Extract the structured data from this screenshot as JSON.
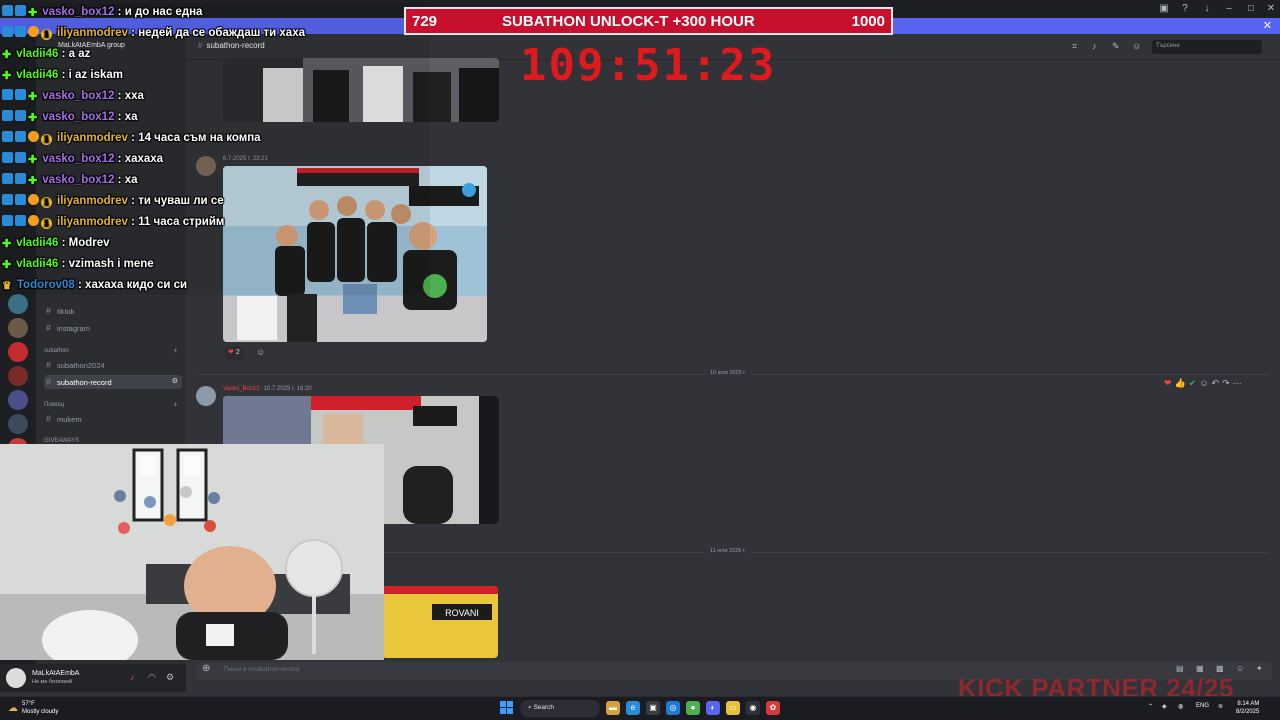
{
  "discord": {
    "server_name": "MaLkAtAEmbA group",
    "channel_header": "subathon-record",
    "search_placeholder": "Търсене",
    "sidebar": {
      "categories": [
        {
          "label": "subathon"
        },
        {
          "label": "Помощ"
        },
        {
          "label": "GIVEAWAYS"
        }
      ],
      "channels": [
        {
          "label": "tiktok"
        },
        {
          "label": "instagram"
        },
        {
          "label": "subathon2024"
        },
        {
          "label": "subathon-record"
        },
        {
          "label": "mukem"
        }
      ]
    },
    "messages": [
      {
        "author": "",
        "time": "6.7.2025 г. 23:21",
        "reaction_count": "2"
      },
      {
        "author": "Vasko_Box12",
        "time": "10.7.2025 г. 16:20"
      }
    ],
    "date_dividers": [
      "10 юли 2025 г.",
      "11 юли 2025 г."
    ],
    "composer_placeholder": "Пиши в #subathon-record",
    "user": {
      "name": "MaLkAtAEmbA",
      "status": "Не ме безпокой"
    }
  },
  "overlay": {
    "banner": {
      "left_value": "729",
      "title": "SUBATHON UNLOCK-T +300 HOUR",
      "right_value": "1000"
    },
    "timer": "109:51:23",
    "kick_partner": "KICK PARTNER 24/25",
    "chat": [
      {
        "badges": [
          "sw",
          "sw",
          "star"
        ],
        "user": "vasko_box12",
        "color": "#a66ee6",
        "text": "и до нас една"
      },
      {
        "badges": [
          "sw",
          "sw",
          "fire",
          "one"
        ],
        "user": "iliyanmodrev",
        "color": "#e6b422",
        "text": "недей да се обаждаш ти хаха"
      },
      {
        "badges": [
          "star"
        ],
        "user": "vladii46",
        "color": "#53fc18",
        "text": "a az"
      },
      {
        "badges": [
          "star"
        ],
        "user": "vladii46",
        "color": "#53fc18",
        "text": "i az iskam"
      },
      {
        "badges": [
          "sw",
          "sw",
          "star"
        ],
        "user": "vasko_box12",
        "color": "#a66ee6",
        "text": "хха"
      },
      {
        "badges": [
          "sw",
          "sw",
          "star"
        ],
        "user": "vasko_box12",
        "color": "#a66ee6",
        "text": "ха"
      },
      {
        "badges": [
          "sw",
          "sw",
          "fire",
          "one"
        ],
        "user": "iliyanmodrev",
        "color": "#e6b422",
        "text": "14 часа съм на компа"
      },
      {
        "badges": [
          "sw",
          "sw",
          "star"
        ],
        "user": "vasko_box12",
        "color": "#a66ee6",
        "text": "хахаха"
      },
      {
        "badges": [
          "sw",
          "sw",
          "star"
        ],
        "user": "vasko_box12",
        "color": "#a66ee6",
        "text": "ха"
      },
      {
        "badges": [
          "sw",
          "sw",
          "fire",
          "one"
        ],
        "user": "iliyanmodrev",
        "color": "#e6b422",
        "text": "ти чуваш ли се"
      },
      {
        "badges": [
          "sw",
          "sw",
          "fire",
          "one"
        ],
        "user": "iliyanmodrev",
        "color": "#e6b422",
        "text": "11 часа стрийм"
      },
      {
        "badges": [
          "star"
        ],
        "user": "vladii46",
        "color": "#53fc18",
        "text": "Modrev"
      },
      {
        "badges": [
          "star"
        ],
        "user": "vladii46",
        "color": "#53fc18",
        "text": "vzimash i mene"
      },
      {
        "badges": [
          "crown"
        ],
        "user": "Todorov08",
        "color": "#2a8bd8",
        "text": "хахаха кидо си си"
      }
    ]
  },
  "taskbar": {
    "weather_temp": "57°F",
    "weather_desc": "Mostly cloudy",
    "search_label": "Search",
    "lang": "ENG",
    "time": "8:14 AM",
    "date": "8/2/2025"
  }
}
